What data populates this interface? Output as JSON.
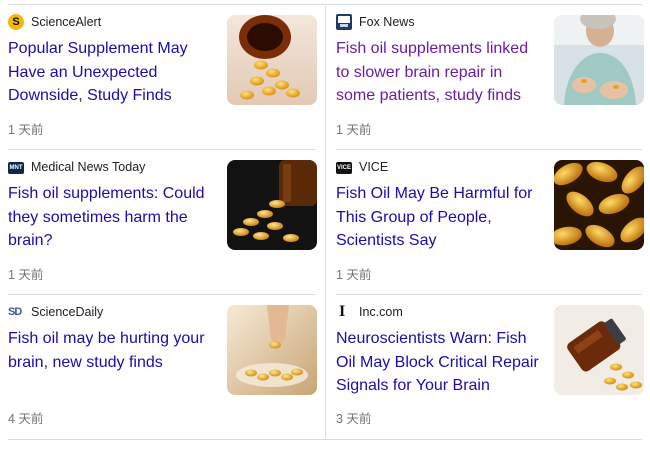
{
  "articles": [
    {
      "source": "ScienceAlert",
      "logo_icon": "sciencealert-logo-icon",
      "title": "Popular Supplement May Have an Unexpected Downside, Study Finds",
      "time": "1 天前",
      "image": "fish-oil-bottle-spill-image",
      "visited": false
    },
    {
      "source": "Fox News",
      "logo_icon": "fox-news-logo-icon",
      "title": "Fish oil supplements linked to slower brain repair in some patients, study finds",
      "time": "1 天前",
      "image": "woman-holding-capsules-image",
      "visited": true
    },
    {
      "source": "Medical News Today",
      "logo_icon": "medical-news-today-logo-icon",
      "title": "Fish oil supplements: Could they sometimes harm the brain?",
      "time": "1 天前",
      "image": "capsules-spilling-from-bottle-image",
      "visited": false
    },
    {
      "source": "VICE",
      "logo_icon": "vice-logo-icon",
      "title": "Fish Oil May Be Harmful for This Group of People, Scientists Say",
      "time": "1 天前",
      "image": "capsules-closeup-image",
      "visited": false
    },
    {
      "source": "ScienceDaily",
      "logo_icon": "sciencedaily-logo-icon",
      "title": "Fish oil may be hurting your brain, new study finds",
      "time": "4 天前",
      "image": "hand-picking-capsule-image",
      "visited": false
    },
    {
      "source": "Inc.com",
      "logo_icon": "inc-logo-icon",
      "title": "Neuroscientists Warn: Fish Oil May Block Critical Repair Signals for Your Brain",
      "time": "3 天前",
      "image": "tilted-bottle-capsules-image",
      "visited": false
    }
  ],
  "colors": {
    "link": "#1a0dab",
    "visited_link": "#681da8",
    "meta_text": "#70757a",
    "divider": "#dadce0",
    "capsule_amber": "#e8a21c"
  }
}
